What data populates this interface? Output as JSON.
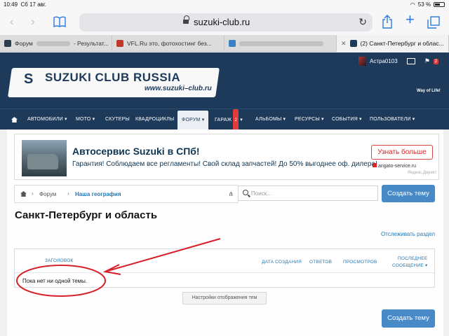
{
  "statusbar": {
    "time": "10:49",
    "date": "Сб 17 авг.",
    "battery": "53 %"
  },
  "browser": {
    "url": "suzuki-club.ru",
    "back_icon": "chevron-left-icon",
    "forward_icon": "chevron-right-icon",
    "bookmarks_icon": "book-icon",
    "reload_icon": "reload-icon",
    "share_icon": "share-icon",
    "new_tab_icon": "plus-icon",
    "tabs_icon": "tabs-icon",
    "tabs": [
      {
        "label": "Форум",
        "suffix": "- Результат..."
      },
      {
        "label": "VFL.Ru это, фотохостинг без..."
      },
      {
        "label": ""
      },
      {
        "label": "(2) Санкт-Петербург и облас..."
      }
    ]
  },
  "site": {
    "logo_title": "SUZUKI CLUB RUSSIA",
    "logo_url": "www.suzuki–club.ru",
    "slogan": "Way of Life!",
    "username": "Астра0103",
    "alerts_count": "2",
    "nav": [
      "АВТОМОБИЛИ ▾",
      "МОТО ▾",
      "СКУТЕРЫ",
      "КВАДРОЦИКЛЫ",
      "ФОРУМ ▾",
      "ГАРАЖ",
      "АЛЬБОМЫ ▾",
      "РЕСУРСЫ ▾",
      "СОБЫТИЯ ▾",
      "ПОЛЬЗОВАТЕЛИ ▾"
    ],
    "garage_badge": "2",
    "garage_arrow": "▾"
  },
  "ad": {
    "title": "Автосервис Suzuki в СПб!",
    "text": "Гарантия! Соблюдаем все регламенты! Свой склад запчастей! До 50% выгоднее оф. дилера!",
    "button": "Узнать больше",
    "domain": "arigato-service.ru",
    "network": "Яндекс.Директ"
  },
  "breadcrumbs": {
    "forum": "Форум",
    "current": "Наша география"
  },
  "search": {
    "placeholder": "Поиск..."
  },
  "page": {
    "title": "Санкт-Петербург и область",
    "create_thread": "Создать тему",
    "watch_section": "Отслеживать раздел",
    "columns": {
      "title": "ЗАГОЛОВОК",
      "created": "ДАТА СОЗДАНИЯ",
      "replies": "ОТВЕТОВ",
      "views": "ПРОСМОТРОВ",
      "last_post_1": "ПОСЛЕДНЕЕ",
      "last_post_2": "СООБЩЕНИЕ ▾"
    },
    "empty_message": "Пока нет ни одной темы.",
    "display_settings": "Настройки отображения тем"
  },
  "annotation_color": "#d61f26"
}
